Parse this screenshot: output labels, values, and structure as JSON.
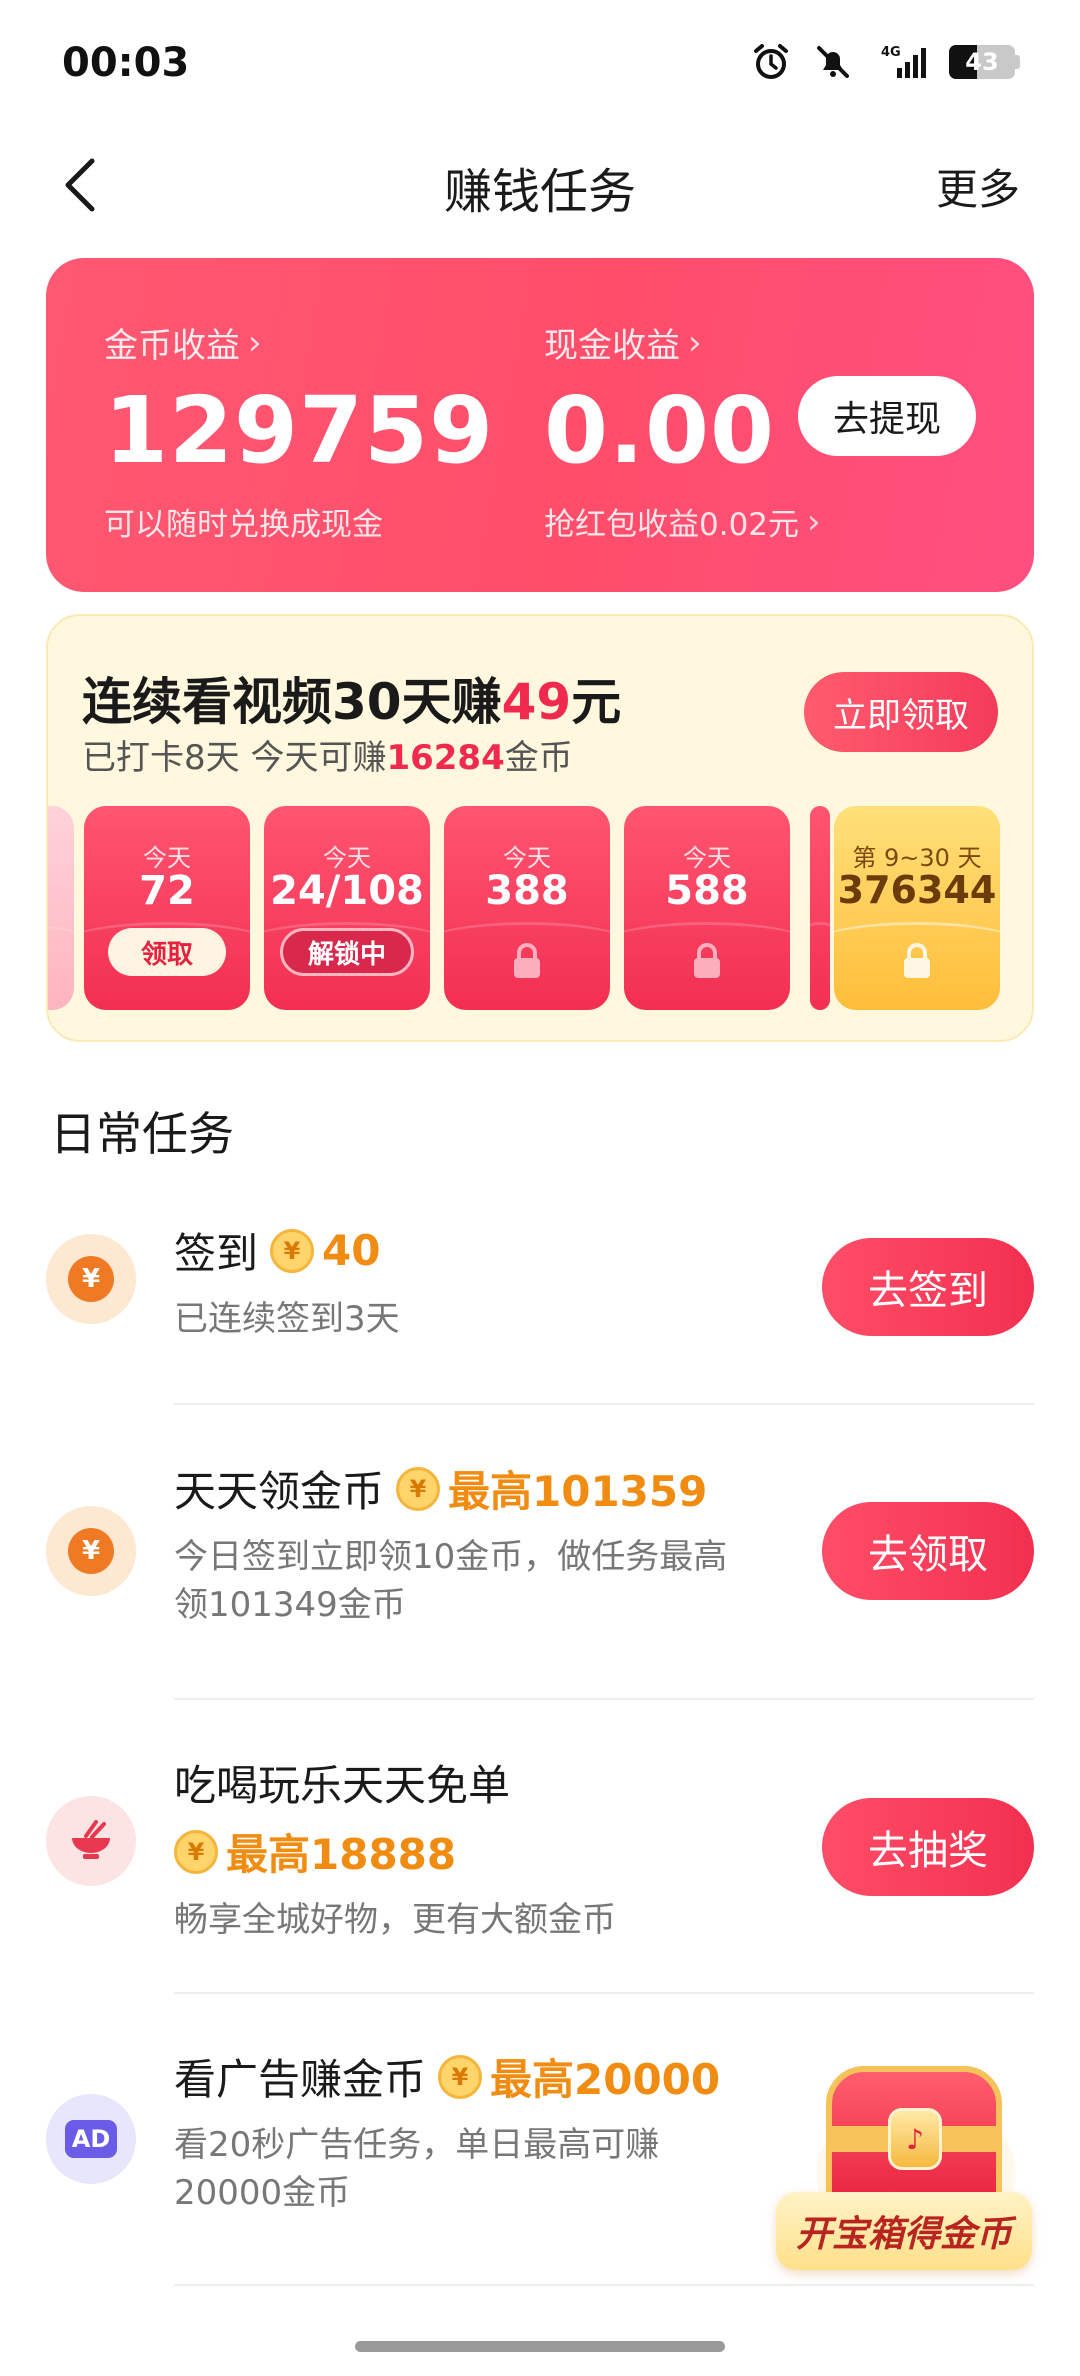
{
  "status_bar": {
    "time": "00:03",
    "network": "4G",
    "battery": "43",
    "battery_level_percent": 43,
    "icons": [
      "alarm-icon",
      "mute-bell-icon",
      "signal-4g-icon",
      "battery-icon"
    ]
  },
  "nav": {
    "title": "赚钱任务",
    "more_label": "更多",
    "back_icon": "chevron-left-icon"
  },
  "earnings": {
    "coins_label": "金币收益",
    "coins_value": "129759",
    "coins_sub": "可以随时兑换成现金",
    "cash_label": "现金收益",
    "cash_value": "0.00",
    "cash_sub": "抢红包收益0.02元",
    "withdraw_label": "去提现",
    "chevron": "›"
  },
  "streak": {
    "title_pre": "连续看视频30天赚",
    "title_amount": "49",
    "title_post": "元",
    "sub_pre": "已打卡8天 今天可赚",
    "sub_amount": "16284",
    "sub_post": "金币",
    "claim_label": "立即领取",
    "envelopes": [
      {
        "day": "今天",
        "amount": "72",
        "action": "领取"
      },
      {
        "day": "今天",
        "amount": "24/108",
        "action": "解锁中"
      },
      {
        "day": "今天",
        "amount": "388",
        "action": ""
      },
      {
        "day": "今天",
        "amount": "588",
        "action": ""
      },
      {
        "day": "第 9~30 天",
        "amount": "376344",
        "action": ""
      }
    ]
  },
  "daily": {
    "section_title": "日常任务",
    "tasks": [
      {
        "name": "签到",
        "reward": "40",
        "desc": "已连续签到3天",
        "button": "去签到",
        "icon": "yen-coin-icon"
      },
      {
        "name": "天天领金币",
        "reward": "最高101359",
        "desc_line1": "今日签到立即领10金币，做任务最高",
        "desc_line2": "领101349金币",
        "button": "去领取",
        "icon": "yen-coin-icon"
      },
      {
        "name": "吃喝玩乐天天免单",
        "reward": "最高18888",
        "desc": "畅享全城好物，更有大额金币",
        "button": "去抽奖",
        "icon": "bowl-icon"
      },
      {
        "name": "看广告赚金币",
        "reward": "最高20000",
        "desc_line1": "看20秒广告任务，单日最高可赚",
        "desc_line2": "20000金币",
        "icon": "ad-icon",
        "icon_text": "AD"
      }
    ],
    "coin_symbol": "¥"
  },
  "treasure": {
    "label": "开宝箱得金币",
    "icon": "treasure-chest-icon"
  },
  "colors": {
    "accent_red": "#f2304f",
    "reward_orange": "#f08c12",
    "card_cream": "#fff8df"
  }
}
